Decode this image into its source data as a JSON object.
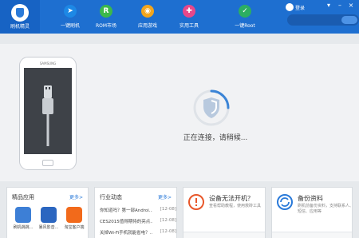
{
  "brand": {
    "label": "刷机精灵"
  },
  "nav": [
    {
      "label": "一键刷机",
      "icon": "cursor-icon",
      "glyph": "➤",
      "color": "#1d88e5"
    },
    {
      "label": "ROM市场",
      "icon": "rom-icon",
      "glyph": "R",
      "color": "#3cb84a"
    },
    {
      "label": "应用游戏",
      "icon": "apps-icon",
      "glyph": "◉",
      "color": "#f2a51d"
    },
    {
      "label": "实用工具",
      "icon": "tools-icon",
      "glyph": "✚",
      "color": "#e8488a"
    },
    {
      "label": "一键Root",
      "icon": "root-icon",
      "glyph": "✓",
      "color": "#2cae62"
    }
  ],
  "user": {
    "login_label": "登录"
  },
  "window": {
    "menu": "▾",
    "minimize": "–",
    "close": "×"
  },
  "phone": {
    "brand": "SAMSUNG"
  },
  "status": {
    "connecting": "正在连接，请稍候..."
  },
  "apps_card": {
    "title": "精品应用",
    "more": "更多>",
    "items": [
      {
        "name": "刷机跳跳...",
        "icon": "game-icon",
        "color": "#3d7fd6"
      },
      {
        "name": "暴风影音...",
        "icon": "video-icon",
        "color": "#2b66c0"
      },
      {
        "name": "淘宝客户端",
        "icon": "taobao-icon",
        "color": "#f26a1b"
      }
    ]
  },
  "news_card": {
    "title": "行业动态",
    "more": "更多>",
    "items": [
      {
        "title": "你知道吗？第一部Androi...",
        "date": "[12-08]"
      },
      {
        "title": "CES2015值得期待的亮点...",
        "date": "[12-08]"
      },
      {
        "title": "关掉Wi-Fi手机就能省电？...",
        "date": "[12-08]"
      }
    ]
  },
  "service_boot": {
    "title": "设备无法开机？",
    "desc": "查看帮助教程，使用救砖工具",
    "icon": "warning-icon",
    "color": "#e8572a"
  },
  "service_backup": {
    "title": "备份资料",
    "desc": "刷机前备份资料，支持联系人、短信、应用等",
    "icon": "sync-icon",
    "color": "#2a7ad9"
  }
}
